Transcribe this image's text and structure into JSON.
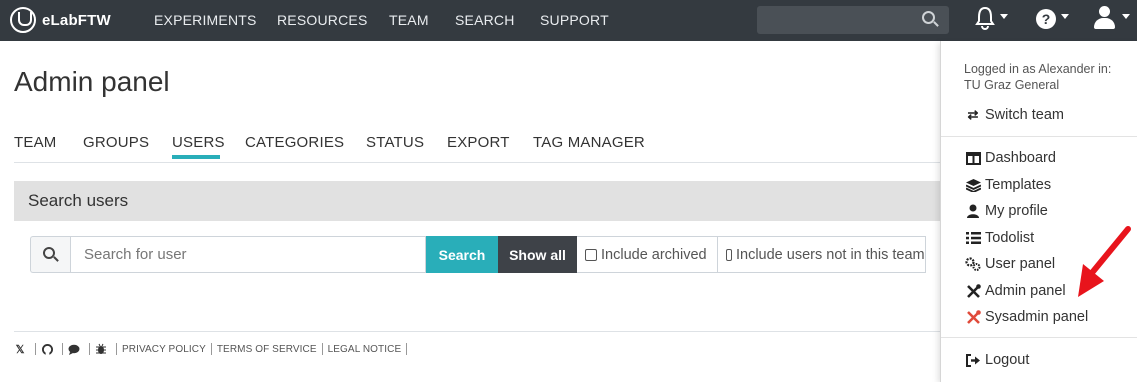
{
  "navbar": {
    "brand": "eLabFTW",
    "links": [
      "EXPERIMENTS",
      "RESOURCES",
      "TEAM",
      "SEARCH",
      "SUPPORT"
    ],
    "help_glyph": "?",
    "icons": [
      "search-icon",
      "bell-icon",
      "help-icon",
      "user-icon"
    ]
  },
  "page": {
    "title": "Admin panel",
    "tabs": [
      "TEAM",
      "GROUPS",
      "USERS",
      "CATEGORIES",
      "STATUS",
      "EXPORT",
      "TAG MANAGER"
    ],
    "active_tab": "USERS"
  },
  "search_users": {
    "title": "Search users",
    "placeholder": "Search for user",
    "search_label": "Search",
    "show_all_label": "Show all",
    "include_archived": "Include archived",
    "include_not_in_team": "Include users not in this team"
  },
  "footer": {
    "icons": [
      "x-icon",
      "github-icon",
      "chat-icon",
      "bug-icon"
    ],
    "links": [
      "PRIVACY POLICY",
      "TERMS OF SERVICE",
      "LEGAL NOTICE"
    ]
  },
  "dropdown": {
    "logged_in_line1": "Logged in as Alexander in:",
    "logged_in_line2": "TU Graz General",
    "switch_team": "Switch team",
    "items": [
      "Dashboard",
      "Templates",
      "My profile",
      "Todolist",
      "User panel",
      "Admin panel",
      "Sysadmin panel"
    ],
    "logout": "Logout"
  },
  "colors": {
    "navbar": "#343a40",
    "accent": "#29aeb9",
    "show_all": "#3e4248",
    "arrow": "#e8141c",
    "sysadmin_icon": "#e04a3a"
  }
}
